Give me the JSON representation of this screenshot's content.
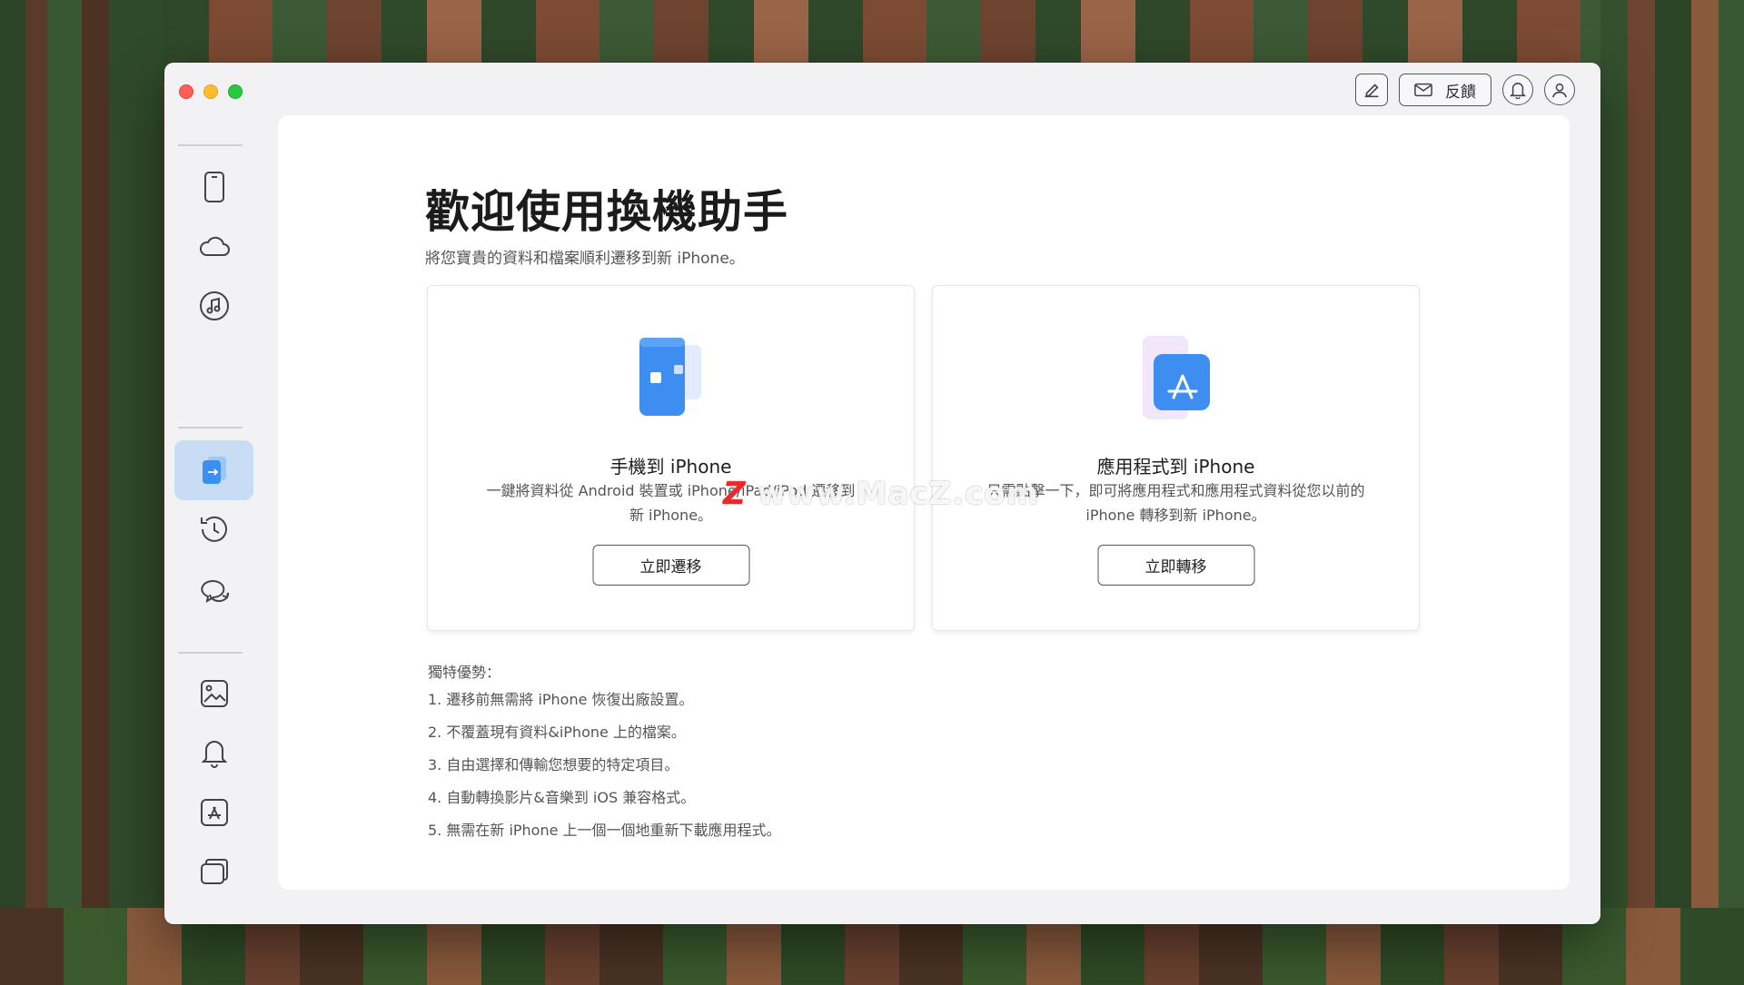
{
  "window": {
    "feedback_label": "反饋"
  },
  "sidebar": {
    "items": [
      {
        "name": "device",
        "icon": "phone-icon"
      },
      {
        "name": "icloud",
        "icon": "cloud-icon"
      },
      {
        "name": "itunes",
        "icon": "music-icon"
      },
      {
        "name": "phone-switcher",
        "icon": "transfer-icon",
        "active": true
      },
      {
        "name": "backup-history",
        "icon": "history-icon"
      },
      {
        "name": "messages",
        "icon": "chat-icon"
      },
      {
        "name": "photo-converter",
        "icon": "photo-convert-icon"
      },
      {
        "name": "ringtone",
        "icon": "bell-icon"
      },
      {
        "name": "app-store",
        "icon": "appstore-icon"
      },
      {
        "name": "screen-mirror",
        "icon": "window-icon"
      }
    ]
  },
  "main": {
    "title": "歡迎使用換機助手",
    "subtitle": "將您寶貴的資料和檔案順利遷移到新 iPhone。",
    "cards": [
      {
        "title": "手機到 iPhone",
        "desc_line1": "一鍵將資料從 Android 裝置或 iPhone/iPad/iPod 遷移到",
        "desc_line2": "新 iPhone。",
        "button": "立即遷移"
      },
      {
        "title": "應用程式到 iPhone",
        "desc_line1": "只需點擊一下，即可將應用程式和應用程式資料從您以前的",
        "desc_line2": "iPhone 轉移到新 iPhone。",
        "button": "立即轉移"
      }
    ],
    "advantages_title": "獨特優勢：",
    "advantages": [
      "1. 遷移前無需將 iPhone 恢復出廠設置。",
      "2. 不覆蓋現有資料&iPhone 上的檔案。",
      "3. 自由選擇和傳輸您想要的特定項目。",
      "4. 自動轉換影片&音樂到 iOS 兼容格式。",
      "5. 無需在新 iPhone 上一個一個地重新下載應用程式。"
    ]
  },
  "watermark": {
    "z": "Z",
    "text": "www.MacZ.com"
  },
  "colors": {
    "accent": "#3b8ff0",
    "active_bg": "#c9dcf5"
  }
}
